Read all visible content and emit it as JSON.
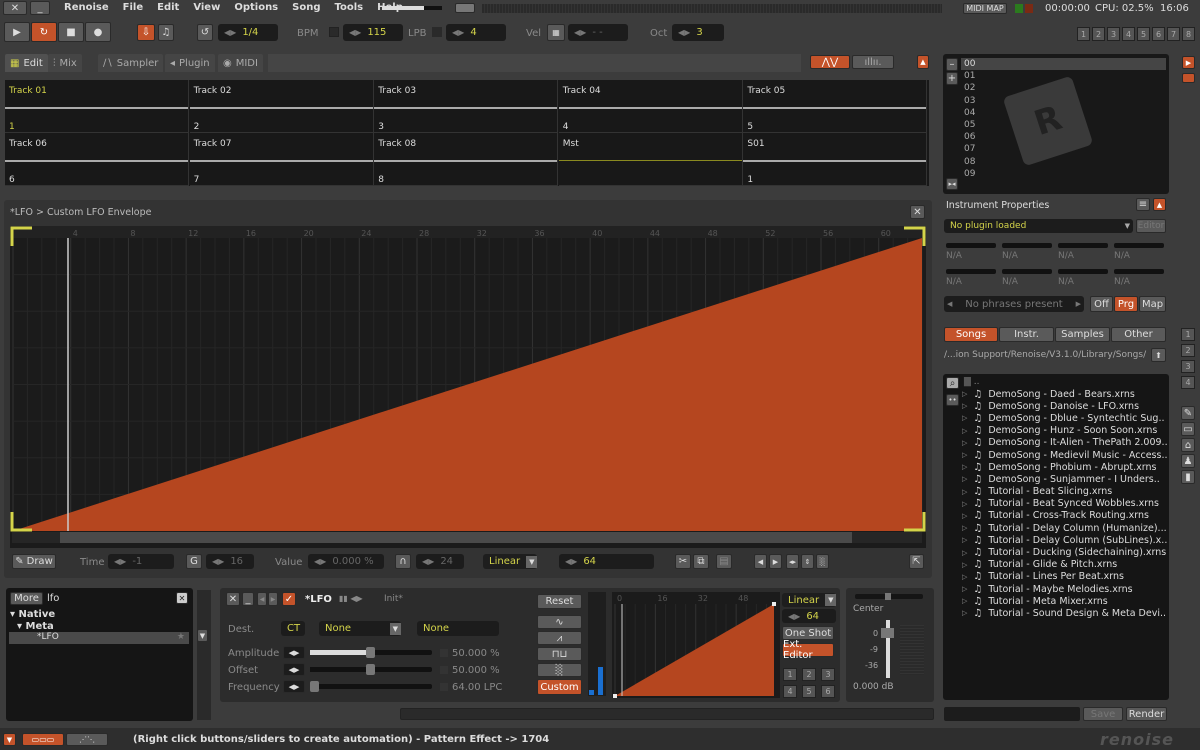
{
  "window": {
    "close": "✕",
    "minimize": "_"
  },
  "menu": [
    "Renoise",
    "File",
    "Edit",
    "View",
    "Options",
    "Song",
    "Tools",
    "Help"
  ],
  "status_top": {
    "midi_map": "MIDI MAP",
    "time": "00:00:00",
    "cpu": "CPU: 02.5%",
    "clock": "16:06"
  },
  "transport": {
    "edit_step": "1/4",
    "bpm_label": "BPM",
    "bpm": "115",
    "lpb_label": "LPB",
    "lpb": "4",
    "vel_label": "Vel",
    "vel": "- -",
    "oct_label": "Oct",
    "oct": "3"
  },
  "track_sets": [
    "1",
    "2",
    "3",
    "4",
    "5",
    "6",
    "7",
    "8"
  ],
  "tabs": [
    "Edit",
    "Mix",
    "Sampler",
    "Plugin",
    "MIDI"
  ],
  "tracks": [
    {
      "name": "Track 01",
      "index": "1"
    },
    {
      "name": "Track 02",
      "index": "2"
    },
    {
      "name": "Track 03",
      "index": "3"
    },
    {
      "name": "Track 04",
      "index": "4"
    },
    {
      "name": "Track 05",
      "index": "5"
    },
    {
      "name": "Track 06",
      "index": "6"
    },
    {
      "name": "Track 07",
      "index": "7"
    },
    {
      "name": "Track 08",
      "index": "8"
    },
    {
      "name": "Mst",
      "index": ""
    },
    {
      "name": "S01",
      "index": "1"
    }
  ],
  "envelope": {
    "title": "*LFO > Custom LFO Envelope",
    "tick_labels": [
      "4",
      "8",
      "12",
      "16",
      "20",
      "24",
      "28",
      "32",
      "36",
      "40",
      "44",
      "48",
      "52",
      "56",
      "60"
    ],
    "length": 64,
    "points": [
      [
        0,
        0
      ],
      [
        63,
        100
      ]
    ],
    "color": "#b5461f",
    "toolbar": {
      "draw": "Draw",
      "time_label": "Time",
      "time": "-1",
      "grid": "16",
      "value_label": "Value",
      "value": "0.000 %",
      "snap": "24",
      "interpolation": "Linear",
      "length": "64"
    }
  },
  "device_browser": {
    "more": "More",
    "search": "lfo",
    "tree": [
      {
        "label": "Native"
      },
      {
        "label": "Meta"
      },
      {
        "label": "*LFO"
      }
    ]
  },
  "lfo": {
    "name": "*LFO",
    "preset": "Init*",
    "dest_label": "Dest.",
    "dest_track": "CT",
    "dest_effect": "None",
    "dest_param": "None",
    "params": [
      {
        "label": "Amplitude",
        "value": "50.000 %",
        "level": 0.5
      },
      {
        "label": "Offset",
        "value": "50.000 %",
        "level": 0.5
      },
      {
        "label": "Frequency",
        "value": "64.00 LPC",
        "level": 0.0
      }
    ],
    "reset": "Reset",
    "custom": "Custom",
    "mini_ticks": [
      "0",
      "16",
      "32",
      "48"
    ],
    "interp": "Linear",
    "length": "64",
    "one_shot": "One Shot",
    "ext_editor": "Ext. Editor",
    "presets": [
      "1",
      "2",
      "3",
      "4",
      "5",
      "6"
    ]
  },
  "mixer": {
    "pan": "Center",
    "scale": [
      "0",
      "-9",
      "-36"
    ],
    "volume": "0.000 dB"
  },
  "instruments": [
    "00",
    "01",
    "02",
    "03",
    "04",
    "05",
    "06",
    "07",
    "08",
    "09"
  ],
  "instrument_props": {
    "title": "Instrument Properties",
    "plugin": "No plugin loaded",
    "editor": "Editor",
    "na": [
      "N/A",
      "N/A",
      "N/A",
      "N/A",
      "N/A",
      "N/A",
      "N/A",
      "N/A"
    ],
    "phrases": "No phrases present",
    "off": "Off",
    "prg": "Prg",
    "map": "Map"
  },
  "browser": {
    "tabs": [
      "Songs",
      "Instr.",
      "Samples",
      "Other"
    ],
    "path": "/...ion Support/Renoise/V3.1.0/Library/Songs/",
    "parent": "..",
    "files": [
      "DemoSong - Daed - Bears.xrns",
      "DemoSong - Danoise - LFO.xrns",
      "DemoSong - Dblue - Syntechtic Sug..",
      "DemoSong - Hunz - Soon Soon.xrns",
      "DemoSong - It-Alien - ThePath 2.009..",
      "DemoSong - Medievil Music - Access..",
      "DemoSong - Phobium - Abrupt.xrns",
      "DemoSong - Sunjammer - I Unders..",
      "Tutorial - Beat Slicing.xrns",
      "Tutorial - Beat Synced Wobbles.xrns",
      "Tutorial - Cross-Track Routing.xrns",
      "Tutorial - Delay Column (Humanize)...",
      "Tutorial - Delay Column (SubLines).x..",
      "Tutorial - Ducking (Sidechaining).xrns",
      "Tutorial - Glide & Pitch.xrns",
      "Tutorial - Lines Per Beat.xrns",
      "Tutorial - Maybe Melodies.xrns",
      "Tutorial - Meta Mixer.xrns",
      "Tutorial - Sound Design & Meta Devi.."
    ],
    "save": "Save",
    "render": "Render"
  },
  "side_numbers": [
    "1",
    "2",
    "3",
    "4"
  ],
  "statusbar": {
    "message": "(Right click buttons/sliders to create automation) - Pattern Effect -> 1704",
    "logo": "renoise"
  },
  "colors": {
    "accent": "#c4532a",
    "highlight": "#d4d44a",
    "envelope": "#b5461f"
  }
}
